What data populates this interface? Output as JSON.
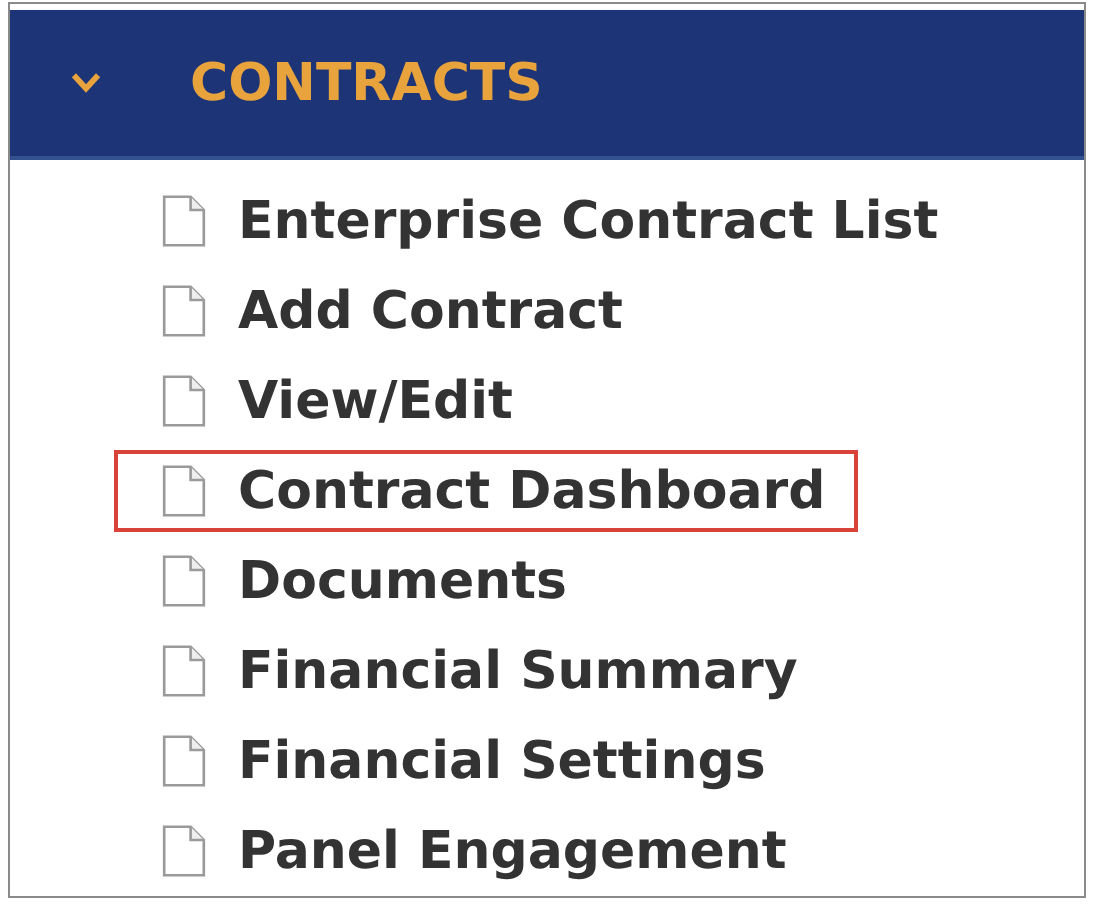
{
  "section": {
    "title": "CONTRACTS",
    "expanded": true
  },
  "items": [
    {
      "label": "Enterprise Contract List",
      "selected": false
    },
    {
      "label": "Add Contract",
      "selected": false
    },
    {
      "label": "View/Edit",
      "selected": false
    },
    {
      "label": "Contract Dashboard",
      "selected": true
    },
    {
      "label": "Documents",
      "selected": false
    },
    {
      "label": "Financial Summary",
      "selected": false
    },
    {
      "label": "Financial Settings",
      "selected": false
    },
    {
      "label": "Panel Engagement",
      "selected": false
    }
  ]
}
